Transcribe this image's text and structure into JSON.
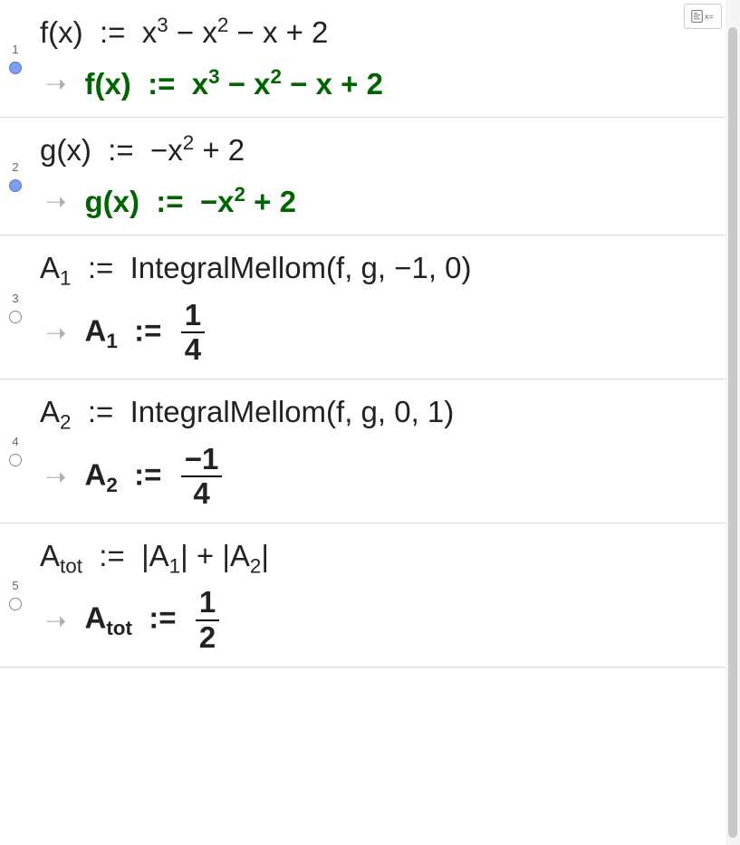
{
  "toolbar": {
    "keyboard_toggle_name": "toggle-keyboard"
  },
  "rows": [
    {
      "num": "1",
      "filled": true,
      "input": {
        "lhs": "f(x)",
        "op": ":=",
        "rhs": "x³ − x² − x + 2"
      },
      "output": {
        "color": "green",
        "lhs": "f(x)",
        "op": ":=",
        "rhs": "x³ − x² − x + 2"
      }
    },
    {
      "num": "2",
      "filled": true,
      "input": {
        "lhs": "g(x)",
        "op": ":=",
        "rhs": "−x² + 2"
      },
      "output": {
        "color": "green",
        "lhs": "g(x)",
        "op": ":=",
        "rhs": "−x² + 2"
      }
    },
    {
      "num": "3",
      "filled": false,
      "input": {
        "lhs": "A₁",
        "op": ":=",
        "rhs": "IntegralMellom(f, g, −1, 0)"
      },
      "output": {
        "color": "black",
        "lhs": "A₁",
        "op": ":=",
        "frac": {
          "num": "1",
          "den": "4"
        }
      }
    },
    {
      "num": "4",
      "filled": false,
      "input": {
        "lhs": "A₂",
        "op": ":=",
        "rhs": "IntegralMellom(f, g, 0, 1)"
      },
      "output": {
        "color": "black",
        "lhs": "A₂",
        "op": ":=",
        "frac": {
          "num": "−1",
          "den": "4"
        }
      }
    },
    {
      "num": "5",
      "filled": false,
      "input": {
        "lhs": "Aₜₒₜ",
        "op": ":=",
        "rhs": "|A₁| + |A₂|"
      },
      "output": {
        "color": "black",
        "lhs": "Aₜₒₜ",
        "op": ":=",
        "frac": {
          "num": "1",
          "den": "2"
        }
      }
    }
  ],
  "chart_data": {
    "type": "table",
    "description": "CAS worksheet defining f, g and computing area between curves",
    "definitions": {
      "f(x)": "x^3 - x^2 - x + 2",
      "g(x)": "-x^2 + 2",
      "A1": {
        "expr": "IntegralMellom(f, g, -1, 0)",
        "value": "1/4"
      },
      "A2": {
        "expr": "IntegralMellom(f, g, 0, 1)",
        "value": "-1/4"
      },
      "A_tot": {
        "expr": "|A1| + |A2|",
        "value": "1/2"
      }
    }
  }
}
